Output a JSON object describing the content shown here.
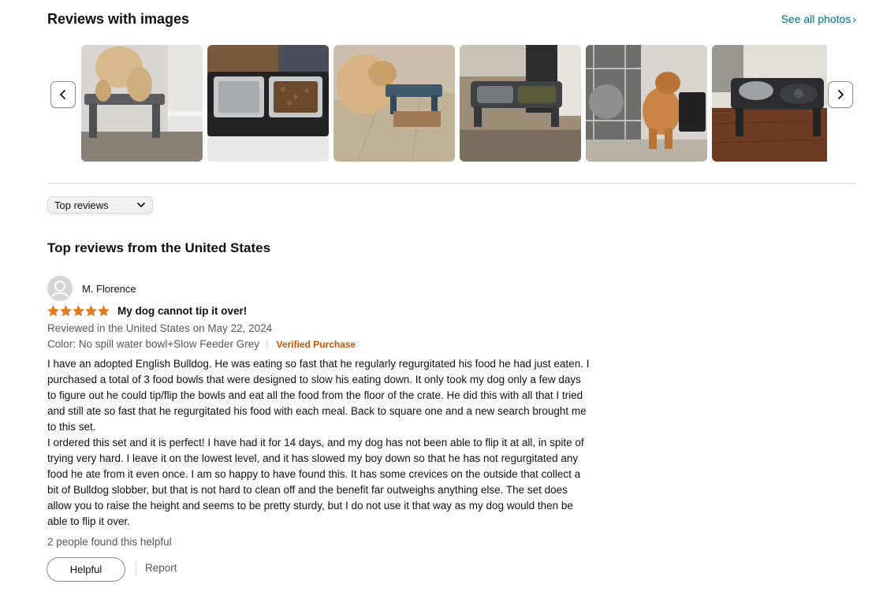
{
  "images_section": {
    "title": "Reviews with images",
    "see_all": "See all photos",
    "thumbnails": [
      {
        "icon": "dog-eating-photo"
      },
      {
        "icon": "bowls-closeup-photo"
      },
      {
        "icon": "golden-dog-photo"
      },
      {
        "icon": "feeder-floor-photo"
      },
      {
        "icon": "bulldog-kitchen-photo"
      },
      {
        "icon": "feeder-wood-floor-photo"
      }
    ]
  },
  "sort": {
    "selected": "Top reviews"
  },
  "reviews_heading": "Top reviews from the United States",
  "review": {
    "reviewer": "M. Florence",
    "rating": 5,
    "rating_max": 5,
    "title": "My dog cannot tip it over!",
    "date": "Reviewed in the United States on May 22, 2024",
    "variant": "Color: No spill water bowl+Slow Feeder Grey",
    "verified": "Verified Purchase",
    "body_p1": "I have an adopted English Bulldog. He was eating so fast that he regularly regurgitated his food he had just eaten. I purchased a total of 3 food bowls that were designed to slow his eating down. It only took my dog only a few days to figure out he could tip/flip the bowls and eat all the food from the floor of the crate. He did this with all that I tried and still ate so fast that he regurgitated his food with each meal. Back to square one and a new search brought me to this set.",
    "body_p2": "I ordered this set and it is perfect! I have had it for 14 days, and my dog has not been able to flip it at all, in spite of trying very hard. I leave it on the lowest level, and it has slowed my boy down so that he has not regurgitated any food he ate from it even once. I am so happy to have found this. It has some crevices on the outside that collect a bit of Bulldog slobber, but that is not hard to clean off and the benefit far outweighs anything else. The set does allow you to raise the height and seems to be pretty sturdy, but I do not use it that way as my dog would then be able to flip it over.",
    "helpful_count": "2 people found this helpful",
    "helpful_button": "Helpful",
    "report": "Report"
  },
  "colors": {
    "link": "#007185",
    "star": "#de7921",
    "verified": "#c45500",
    "muted": "#565959"
  }
}
